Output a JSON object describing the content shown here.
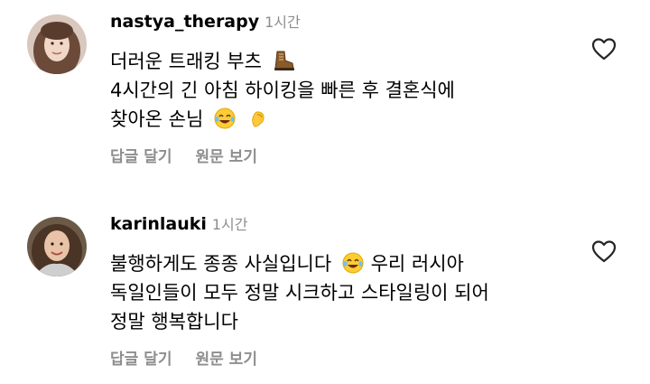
{
  "comments": [
    {
      "username": "nastya_therapy",
      "time": "1시간",
      "lines": [
        "더러운 트래킹 부츠",
        "4시간의 긴 아침 하이킹을 빠른 후 결혼식에",
        "찾아온 손님"
      ],
      "emojis": [
        "hiking-boot-icon",
        "laughing-tears-icon",
        "pinching-hand-icon"
      ],
      "reply_label": "답글 달기",
      "view_label": "원문 보기"
    },
    {
      "username": "karinlauki",
      "time": "1시간",
      "lines": [
        "불행하게도 종종 사실입니다",
        "우리 러시아",
        "독일인들이 모두 정말 시크하고 스타일링이 되어",
        "정말 행복합니다"
      ],
      "emojis": [
        "laughing-tears-icon"
      ],
      "reply_label": "답글 달기",
      "view_label": "원문 보기"
    }
  ],
  "colors": {
    "text": "#000000",
    "secondary": "#8e8e8e",
    "heart_outline": "#262626",
    "background": "#ffffff"
  }
}
